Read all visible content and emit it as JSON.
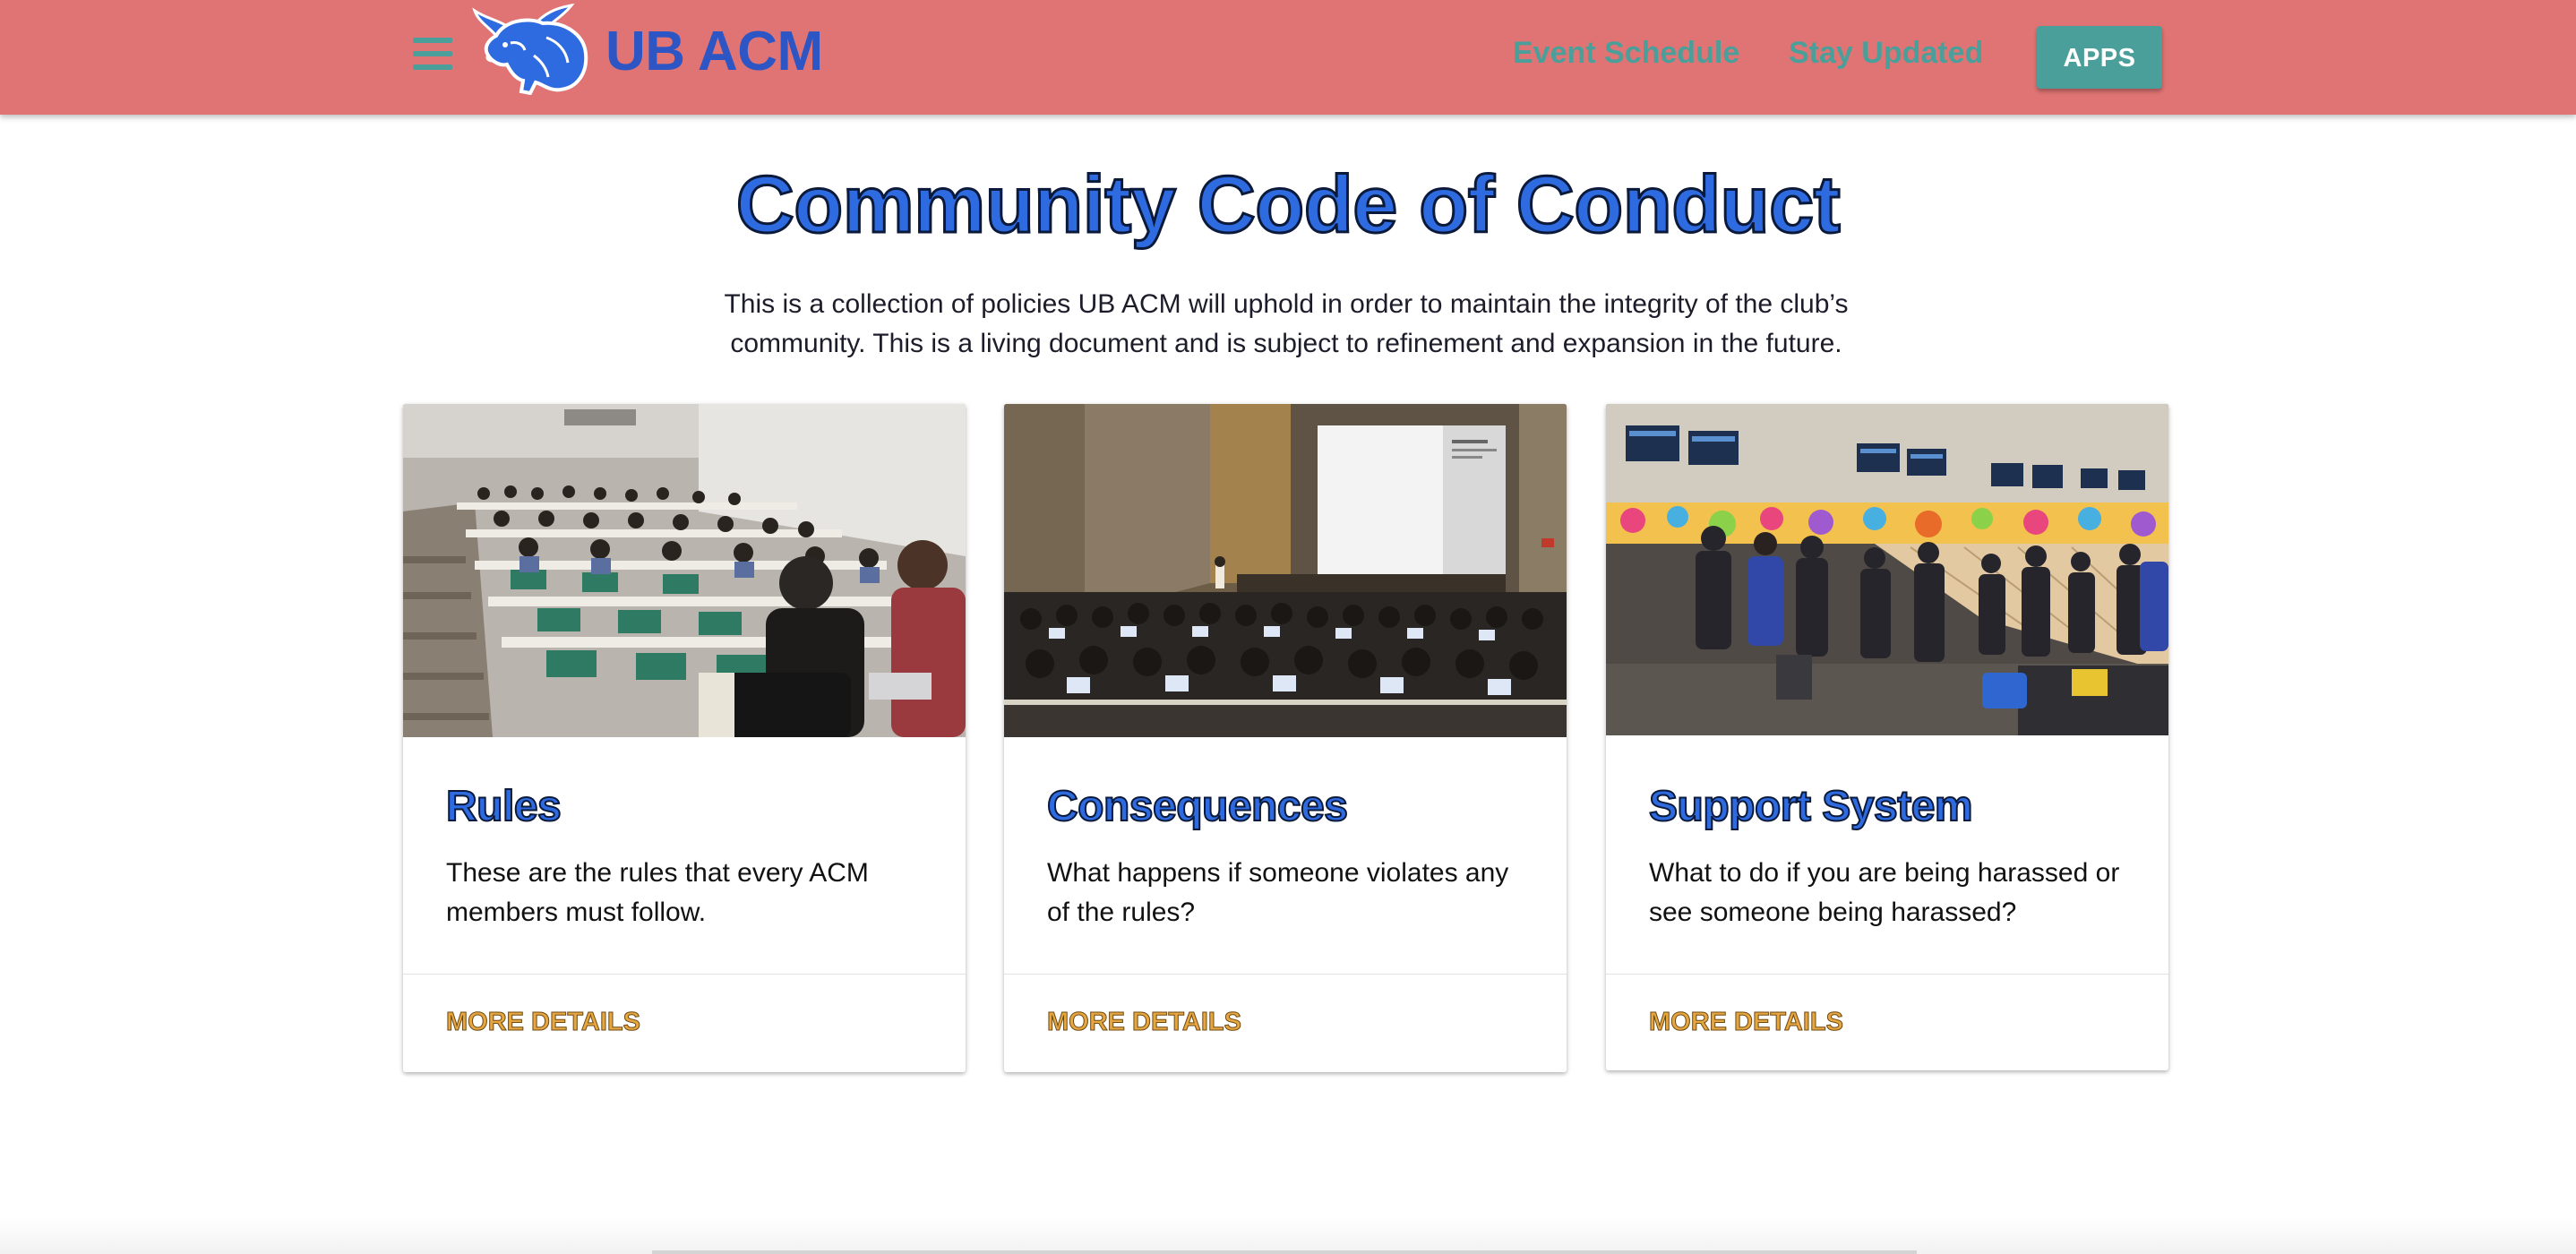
{
  "navbar": {
    "brand": "UB ACM",
    "links": [
      "Event Schedule",
      "Stay Updated"
    ],
    "apps_label": "APPS",
    "colors": {
      "background": "#e07474",
      "accent": "#4a9f9a",
      "brand": "#2d56c4"
    }
  },
  "header": {
    "title": "Community Code of Conduct",
    "intro": "This is a collection of policies UB ACM will uphold in order to maintain the integrity of the club’s community. This is a living document and is subject to refinement and expansion in the future."
  },
  "cards": [
    {
      "image": "lecture-hall-photo",
      "title": "Rules",
      "text": "These are the rules that every ACM members must follow.",
      "action": "MORE DETAILS"
    },
    {
      "image": "auditorium-presentation-photo",
      "title": "Consequences",
      "text": "What happens if someone violates any of the rules?",
      "action": "MORE DETAILS"
    },
    {
      "image": "bowling-alley-photo",
      "title": "Support System",
      "text": "What to do if you are being harassed or see someone being harassed?",
      "action": "MORE DETAILS"
    }
  ]
}
